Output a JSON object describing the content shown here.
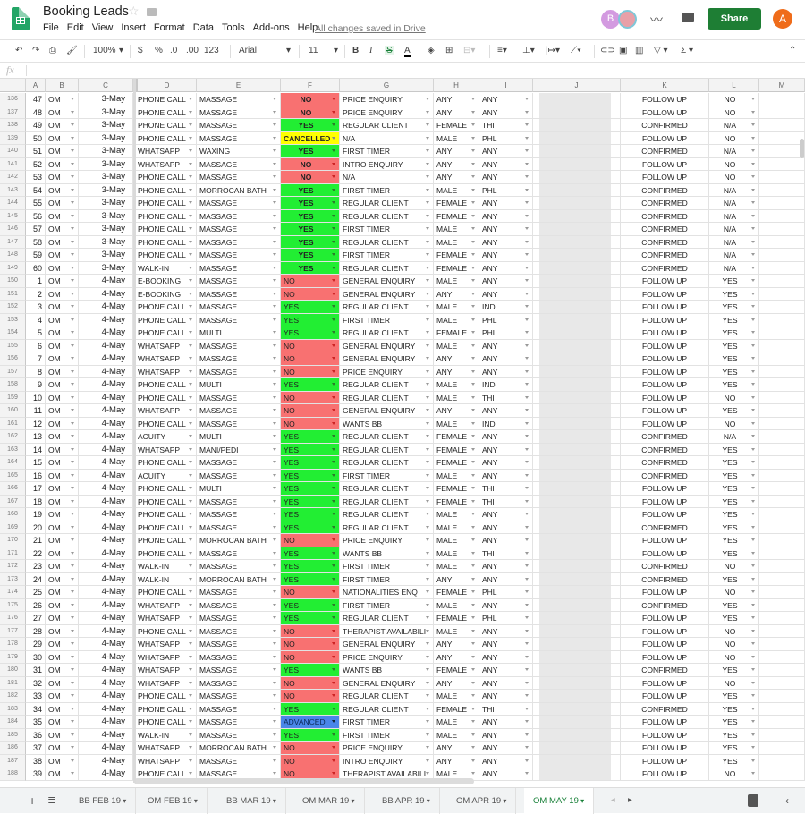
{
  "app": {
    "title": "Booking Leads",
    "menu": [
      "File",
      "Edit",
      "View",
      "Insert",
      "Format",
      "Data",
      "Tools",
      "Add-ons",
      "Help"
    ],
    "save_status": "All changes saved in Drive",
    "share_label": "Share",
    "avatar_b": "B",
    "avatar_a": "A"
  },
  "toolbar": {
    "zoom": "100%",
    "currency": "$",
    "percent": "%",
    "dec_less": ".0",
    "dec_more": ".00",
    "format_more": "123",
    "font": "Arial",
    "font_size": "11",
    "bold": "B",
    "italic": "I",
    "strike": "S",
    "text_color": "A"
  },
  "formula_bar": {
    "fx": "fx",
    "value": ""
  },
  "columns": [
    "A",
    "B",
    "C",
    "D",
    "E",
    "F",
    "G",
    "H",
    "I",
    "J",
    "K",
    "L",
    "M"
  ],
  "status_colors": {
    "NO": "#f87171",
    "YES": "#22ee33",
    "CANCELLED": "#ffff00",
    "ADVANCED": "#4a86e8"
  },
  "rows": [
    {
      "n": "136",
      "a": "47",
      "b": "OM",
      "c": "3-May",
      "d": "PHONE CALL",
      "e": "MASSAGE",
      "f": "NO",
      "fc": true,
      "g": "PRICE ENQUIRY",
      "h": "ANY",
      "i": "ANY",
      "k": "FOLLOW UP",
      "l": "NO"
    },
    {
      "n": "137",
      "a": "48",
      "b": "OM",
      "c": "3-May",
      "d": "PHONE CALL",
      "e": "MASSAGE",
      "f": "NO",
      "fc": true,
      "g": "PRICE ENQUIRY",
      "h": "ANY",
      "i": "ANY",
      "k": "FOLLOW UP",
      "l": "NO"
    },
    {
      "n": "138",
      "a": "49",
      "b": "OM",
      "c": "3-May",
      "d": "PHONE CALL",
      "e": "MASSAGE",
      "f": "YES",
      "fc": true,
      "g": "REGULAR CLIENT",
      "h": "FEMALE",
      "i": "THI",
      "k": "CONFIRMED",
      "l": "N/A"
    },
    {
      "n": "139",
      "a": "50",
      "b": "OM",
      "c": "3-May",
      "d": "PHONE CALL",
      "e": "MASSAGE",
      "f": "CANCELLED",
      "fc": true,
      "g": "N/A",
      "h": "MALE",
      "i": "PHL",
      "k": "FOLLOW UP",
      "l": "NO"
    },
    {
      "n": "140",
      "a": "51",
      "b": "OM",
      "c": "3-May",
      "d": "WHATSAPP",
      "e": "WAXING",
      "f": "YES",
      "fc": true,
      "g": "FIRST TIMER",
      "h": "ANY",
      "i": "ANY",
      "k": "CONFIRMED",
      "l": "N/A"
    },
    {
      "n": "141",
      "a": "52",
      "b": "OM",
      "c": "3-May",
      "d": "WHATSAPP",
      "e": "MASSAGE",
      "f": "NO",
      "fc": true,
      "g": "INTRO ENQUIRY",
      "h": "ANY",
      "i": "ANY",
      "k": "FOLLOW UP",
      "l": "NO"
    },
    {
      "n": "142",
      "a": "53",
      "b": "OM",
      "c": "3-May",
      "d": "PHONE CALL",
      "e": "MASSAGE",
      "f": "NO",
      "fc": true,
      "g": "N/A",
      "h": "ANY",
      "i": "ANY",
      "k": "FOLLOW UP",
      "l": "NO"
    },
    {
      "n": "143",
      "a": "54",
      "b": "OM",
      "c": "3-May",
      "d": "PHONE CALL",
      "e": "MORROCAN BATH",
      "f": "YES",
      "fc": true,
      "g": "FIRST TIMER",
      "h": "MALE",
      "i": "PHL",
      "k": "CONFIRMED",
      "l": "N/A"
    },
    {
      "n": "144",
      "a": "55",
      "b": "OM",
      "c": "3-May",
      "d": "PHONE CALL",
      "e": "MASSAGE",
      "f": "YES",
      "fc": true,
      "g": "REGULAR CLIENT",
      "h": "FEMALE",
      "i": "ANY",
      "k": "CONFIRMED",
      "l": "N/A"
    },
    {
      "n": "145",
      "a": "56",
      "b": "OM",
      "c": "3-May",
      "d": "PHONE CALL",
      "e": "MASSAGE",
      "f": "YES",
      "fc": true,
      "g": "REGULAR CLIENT",
      "h": "FEMALE",
      "i": "ANY",
      "k": "CONFIRMED",
      "l": "N/A"
    },
    {
      "n": "146",
      "a": "57",
      "b": "OM",
      "c": "3-May",
      "d": "PHONE CALL",
      "e": "MASSAGE",
      "f": "YES",
      "fc": true,
      "g": "FIRST TIMER",
      "h": "MALE",
      "i": "ANY",
      "k": "CONFIRMED",
      "l": "N/A"
    },
    {
      "n": "147",
      "a": "58",
      "b": "OM",
      "c": "3-May",
      "d": "PHONE CALL",
      "e": "MASSAGE",
      "f": "YES",
      "fc": true,
      "g": "REGULAR CLIENT",
      "h": "MALE",
      "i": "ANY",
      "k": "CONFIRMED",
      "l": "N/A"
    },
    {
      "n": "148",
      "a": "59",
      "b": "OM",
      "c": "3-May",
      "d": "PHONE CALL",
      "e": "MASSAGE",
      "f": "YES",
      "fc": true,
      "g": "FIRST TIMER",
      "h": "FEMALE",
      "i": "ANY",
      "k": "CONFIRMED",
      "l": "N/A"
    },
    {
      "n": "149",
      "a": "60",
      "b": "OM",
      "c": "3-May",
      "d": "WALK-IN",
      "e": "MASSAGE",
      "f": "YES",
      "fc": true,
      "g": "REGULAR CLIENT",
      "h": "FEMALE",
      "i": "ANY",
      "k": "CONFIRMED",
      "l": "N/A"
    },
    {
      "n": "150",
      "a": "1",
      "b": "OM",
      "c": "4-May",
      "d": "E-BOOKING",
      "e": "MASSAGE",
      "f": "NO",
      "g": "GENERAL ENQUIRY",
      "h": "MALE",
      "i": "ANY",
      "k": "FOLLOW UP",
      "l": "YES"
    },
    {
      "n": "151",
      "a": "2",
      "b": "OM",
      "c": "4-May",
      "d": "E-BOOKING",
      "e": "MASSAGE",
      "f": "NO",
      "g": "GENERAL ENQUIRY",
      "h": "ANY",
      "i": "ANY",
      "k": "FOLLOW UP",
      "l": "YES"
    },
    {
      "n": "152",
      "a": "3",
      "b": "OM",
      "c": "4-May",
      "d": "PHONE CALL",
      "e": "MASSAGE",
      "f": "YES",
      "g": "REGULAR CLIENT",
      "h": "MALE",
      "i": "IND",
      "k": "FOLLOW UP",
      "l": "YES"
    },
    {
      "n": "153",
      "a": "4",
      "b": "OM",
      "c": "4-May",
      "d": "PHONE CALL",
      "e": "MASSAGE",
      "f": "YES",
      "g": "FIRST TIMER",
      "h": "MALE",
      "i": "PHL",
      "k": "FOLLOW UP",
      "l": "YES"
    },
    {
      "n": "154",
      "a": "5",
      "b": "OM",
      "c": "4-May",
      "d": "PHONE CALL",
      "e": "MULTI",
      "f": "YES",
      "g": "REGULAR CLIENT",
      "h": "FEMALE",
      "i": "PHL",
      "k": "FOLLOW UP",
      "l": "YES"
    },
    {
      "n": "155",
      "a": "6",
      "b": "OM",
      "c": "4-May",
      "d": "WHATSAPP",
      "e": "MASSAGE",
      "f": "NO",
      "g": "GENERAL ENQUIRY",
      "h": "MALE",
      "i": "ANY",
      "k": "FOLLOW UP",
      "l": "YES"
    },
    {
      "n": "156",
      "a": "7",
      "b": "OM",
      "c": "4-May",
      "d": "WHATSAPP",
      "e": "MASSAGE",
      "f": "NO",
      "g": "GENERAL ENQUIRY",
      "h": "ANY",
      "i": "ANY",
      "k": "FOLLOW UP",
      "l": "YES"
    },
    {
      "n": "157",
      "a": "8",
      "b": "OM",
      "c": "4-May",
      "d": "WHATSAPP",
      "e": "MASSAGE",
      "f": "NO",
      "g": "PRICE ENQUIRY",
      "h": "ANY",
      "i": "ANY",
      "k": "FOLLOW UP",
      "l": "YES"
    },
    {
      "n": "158",
      "a": "9",
      "b": "OM",
      "c": "4-May",
      "d": "PHONE CALL",
      "e": "MULTI",
      "f": "YES",
      "g": "REGULAR CLIENT",
      "h": "MALE",
      "i": "IND",
      "k": "FOLLOW UP",
      "l": "YES"
    },
    {
      "n": "159",
      "a": "10",
      "b": "OM",
      "c": "4-May",
      "d": "PHONE CALL",
      "e": "MASSAGE",
      "f": "NO",
      "g": "REGULAR CLIENT",
      "h": "MALE",
      "i": "THI",
      "k": "FOLLOW UP",
      "l": "NO"
    },
    {
      "n": "160",
      "a": "11",
      "b": "OM",
      "c": "4-May",
      "d": "WHATSAPP",
      "e": "MASSAGE",
      "f": "NO",
      "g": "GENERAL ENQUIRY",
      "h": "ANY",
      "i": "ANY",
      "k": "FOLLOW UP",
      "l": "YES"
    },
    {
      "n": "161",
      "a": "12",
      "b": "OM",
      "c": "4-May",
      "d": "PHONE CALL",
      "e": "MASSAGE",
      "f": "NO",
      "g": "WANTS BB",
      "h": "MALE",
      "i": "IND",
      "k": "FOLLOW UP",
      "l": "NO"
    },
    {
      "n": "162",
      "a": "13",
      "b": "OM",
      "c": "4-May",
      "d": "ACUITY",
      "e": "MULTI",
      "f": "YES",
      "g": "REGULAR CLIENT",
      "h": "FEMALE",
      "i": "ANY",
      "k": "CONFIRMED",
      "l": "N/A"
    },
    {
      "n": "163",
      "a": "14",
      "b": "OM",
      "c": "4-May",
      "d": "WHATSAPP",
      "e": "MANI/PEDI",
      "f": "YES",
      "g": "REGULAR CLIENT",
      "h": "FEMALE",
      "i": "ANY",
      "k": "CONFIRMED",
      "l": "YES"
    },
    {
      "n": "164",
      "a": "15",
      "b": "OM",
      "c": "4-May",
      "d": "PHONE CALL",
      "e": "MASSAGE",
      "f": "YES",
      "g": "REGULAR CLIENT",
      "h": "FEMALE",
      "i": "ANY",
      "k": "CONFIRMED",
      "l": "YES"
    },
    {
      "n": "165",
      "a": "16",
      "b": "OM",
      "c": "4-May",
      "d": "ACUITY",
      "e": "MASSAGE",
      "f": "YES",
      "g": "FIRST TIMER",
      "h": "MALE",
      "i": "ANY",
      "k": "CONFIRMED",
      "l": "YES"
    },
    {
      "n": "166",
      "a": "17",
      "b": "OM",
      "c": "4-May",
      "d": "PHONE CALL",
      "e": "MULTI",
      "f": "YES",
      "g": "REGULAR CLIENT",
      "h": "FEMALE",
      "i": "THI",
      "k": "FOLLOW UP",
      "l": "YES"
    },
    {
      "n": "167",
      "a": "18",
      "b": "OM",
      "c": "4-May",
      "d": "PHONE CALL",
      "e": "MASSAGE",
      "f": "YES",
      "g": "REGULAR CLIENT",
      "h": "FEMALE",
      "i": "THI",
      "k": "FOLLOW UP",
      "l": "YES"
    },
    {
      "n": "168",
      "a": "19",
      "b": "OM",
      "c": "4-May",
      "d": "PHONE CALL",
      "e": "MASSAGE",
      "f": "YES",
      "g": "REGULAR CLIENT",
      "h": "MALE",
      "i": "ANY",
      "k": "FOLLOW UP",
      "l": "YES"
    },
    {
      "n": "169",
      "a": "20",
      "b": "OM",
      "c": "4-May",
      "d": "PHONE CALL",
      "e": "MASSAGE",
      "f": "YES",
      "g": "REGULAR CLIENT",
      "h": "MALE",
      "i": "ANY",
      "k": "CONFIRMED",
      "l": "YES"
    },
    {
      "n": "170",
      "a": "21",
      "b": "OM",
      "c": "4-May",
      "d": "PHONE CALL",
      "e": "MORROCAN BATH",
      "f": "NO",
      "g": "PRICE ENQUIRY",
      "h": "MALE",
      "i": "ANY",
      "k": "FOLLOW UP",
      "l": "YES"
    },
    {
      "n": "171",
      "a": "22",
      "b": "OM",
      "c": "4-May",
      "d": "PHONE CALL",
      "e": "MASSAGE",
      "f": "YES",
      "g": "WANTS BB",
      "h": "MALE",
      "i": "THI",
      "k": "FOLLOW UP",
      "l": "YES"
    },
    {
      "n": "172",
      "a": "23",
      "b": "OM",
      "c": "4-May",
      "d": "WALK-IN",
      "e": "MASSAGE",
      "f": "YES",
      "g": "FIRST TIMER",
      "h": "MALE",
      "i": "ANY",
      "k": "CONFIRMED",
      "l": "NO"
    },
    {
      "n": "173",
      "a": "24",
      "b": "OM",
      "c": "4-May",
      "d": "WALK-IN",
      "e": "MORROCAN BATH",
      "f": "YES",
      "g": "FIRST TIMER",
      "h": "ANY",
      "i": "ANY",
      "k": "CONFIRMED",
      "l": "YES"
    },
    {
      "n": "174",
      "a": "25",
      "b": "OM",
      "c": "4-May",
      "d": "PHONE CALL",
      "e": "MASSAGE",
      "f": "NO",
      "g": "NATIONALITIES ENQ",
      "h": "FEMALE",
      "i": "PHL",
      "k": "FOLLOW UP",
      "l": "NO"
    },
    {
      "n": "175",
      "a": "26",
      "b": "OM",
      "c": "4-May",
      "d": "WHATSAPP",
      "e": "MASSAGE",
      "f": "YES",
      "g": "FIRST TIMER",
      "h": "MALE",
      "i": "ANY",
      "k": "CONFIRMED",
      "l": "YES"
    },
    {
      "n": "176",
      "a": "27",
      "b": "OM",
      "c": "4-May",
      "d": "WHATSAPP",
      "e": "MASSAGE",
      "f": "YES",
      "g": "REGULAR CLIENT",
      "h": "FEMALE",
      "i": "PHL",
      "k": "FOLLOW UP",
      "l": "YES"
    },
    {
      "n": "177",
      "a": "28",
      "b": "OM",
      "c": "4-May",
      "d": "PHONE CALL",
      "e": "MASSAGE",
      "f": "NO",
      "g": "THERAPIST AVAILABILI",
      "h": "MALE",
      "i": "ANY",
      "k": "FOLLOW UP",
      "l": "NO"
    },
    {
      "n": "178",
      "a": "29",
      "b": "OM",
      "c": "4-May",
      "d": "WHATSAPP",
      "e": "MASSAGE",
      "f": "NO",
      "g": "GENERAL ENQUIRY",
      "h": "ANY",
      "i": "ANY",
      "k": "FOLLOW UP",
      "l": "NO"
    },
    {
      "n": "179",
      "a": "30",
      "b": "OM",
      "c": "4-May",
      "d": "WHATSAPP",
      "e": "MASSAGE",
      "f": "NO",
      "g": "PRICE ENQUIRY",
      "h": "ANY",
      "i": "ANY",
      "k": "FOLLOW UP",
      "l": "NO"
    },
    {
      "n": "180",
      "a": "31",
      "b": "OM",
      "c": "4-May",
      "d": "WHATSAPP",
      "e": "MASSAGE",
      "f": "YES",
      "g": "WANTS BB",
      "h": "FEMALE",
      "i": "ANY",
      "k": "CONFIRMED",
      "l": "YES"
    },
    {
      "n": "181",
      "a": "32",
      "b": "OM",
      "c": "4-May",
      "d": "WHATSAPP",
      "e": "MASSAGE",
      "f": "NO",
      "g": "GENERAL ENQUIRY",
      "h": "ANY",
      "i": "ANY",
      "k": "FOLLOW UP",
      "l": "NO"
    },
    {
      "n": "182",
      "a": "33",
      "b": "OM",
      "c": "4-May",
      "d": "PHONE CALL",
      "e": "MASSAGE",
      "f": "NO",
      "g": "REGULAR CLIENT",
      "h": "MALE",
      "i": "ANY",
      "k": "FOLLOW UP",
      "l": "YES"
    },
    {
      "n": "183",
      "a": "34",
      "b": "OM",
      "c": "4-May",
      "d": "PHONE CALL",
      "e": "MASSAGE",
      "f": "YES",
      "g": "REGULAR CLIENT",
      "h": "FEMALE",
      "i": "THI",
      "k": "CONFIRMED",
      "l": "YES"
    },
    {
      "n": "184",
      "a": "35",
      "b": "OM",
      "c": "4-May",
      "d": "PHONE CALL",
      "e": "MASSAGE",
      "f": "ADVANCED",
      "g": "FIRST TIMER",
      "h": "MALE",
      "i": "ANY",
      "k": "FOLLOW UP",
      "l": "YES"
    },
    {
      "n": "185",
      "a": "36",
      "b": "OM",
      "c": "4-May",
      "d": "WALK-IN",
      "e": "MASSAGE",
      "f": "YES",
      "g": "FIRST TIMER",
      "h": "MALE",
      "i": "ANY",
      "k": "FOLLOW UP",
      "l": "YES"
    },
    {
      "n": "186",
      "a": "37",
      "b": "OM",
      "c": "4-May",
      "d": "WHATSAPP",
      "e": "MORROCAN BATH",
      "f": "NO",
      "g": "PRICE ENQUIRY",
      "h": "ANY",
      "i": "ANY",
      "k": "FOLLOW UP",
      "l": "YES"
    },
    {
      "n": "187",
      "a": "38",
      "b": "OM",
      "c": "4-May",
      "d": "WHATSAPP",
      "e": "MASSAGE",
      "f": "NO",
      "g": "INTRO ENQUIRY",
      "h": "ANY",
      "i": "ANY",
      "k": "FOLLOW UP",
      "l": "YES"
    },
    {
      "n": "188",
      "a": "39",
      "b": "OM",
      "c": "4-May",
      "d": "PHONE CALL",
      "e": "MASSAGE",
      "f": "NO",
      "g": "THERAPIST AVAILABILI",
      "h": "MALE",
      "i": "ANY",
      "k": "FOLLOW UP",
      "l": "NO"
    }
  ],
  "sheet_tabs": [
    {
      "label": "BB FEB 19",
      "active": false
    },
    {
      "label": "OM FEB 19",
      "active": false
    },
    {
      "label": "BB MAR 19",
      "active": false
    },
    {
      "label": "OM MAR 19",
      "active": false
    },
    {
      "label": "BB APR 19",
      "active": false
    },
    {
      "label": "OM APR 19",
      "active": false
    },
    {
      "label": "OM MAY 19",
      "active": true
    }
  ]
}
